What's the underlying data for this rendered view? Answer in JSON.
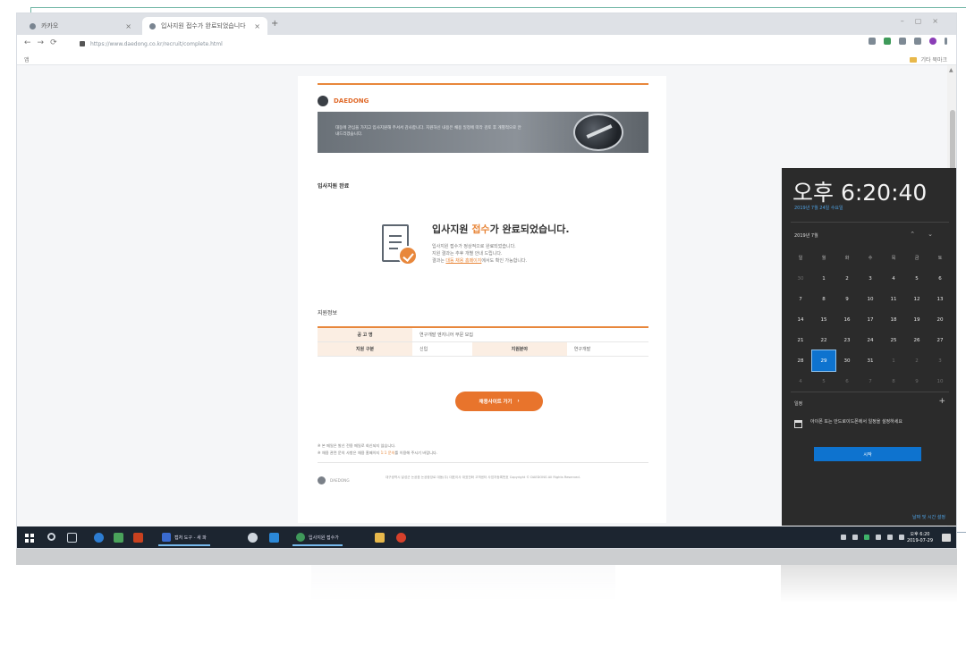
{
  "browser": {
    "tabs": [
      {
        "label": "카카오",
        "active": false
      },
      {
        "label": "입사지원 접수가 완료되었습니다",
        "active": true
      }
    ],
    "new_tab": "+",
    "url": "https://www.daedong.co.kr/recruit/complete.html",
    "bookmarks_left": "앱",
    "bookmarks_right": "기타 북마크"
  },
  "email": {
    "brand": "DAEDONG",
    "banner_text": "대동에 관심을 가지고 입사지원해 주셔서 감사합니다. 지원하신 내용은 채용 일정에 따라 검토 후 개별적으로 안내드리겠습니다.",
    "section_title": "입사지원 완료",
    "headline_prefix": "입사지원 ",
    "headline_emphasis": "접수",
    "headline_suffix": "가 완료되었습니다.",
    "notice_line1": "입사지원 접수가 정상적으로 완료되었습니다.",
    "notice_line2": "지원 결과는 추후 개별 안내 드립니다.",
    "notice_line3_prefix": "결과는 ",
    "notice_line3_link": "대동 채용 홈페이지",
    "notice_line3_suffix": "에서도 확인 가능합니다.",
    "info_title": "지원정보",
    "table": {
      "row1_header": "공 고 명",
      "row1_value": "연구개발 엔지니어 부문 모집",
      "row2_header1": "지원 구분",
      "row2_value1": "신입",
      "row2_header2": "지원분야",
      "row2_value2": "연구개발"
    },
    "cta_label": "채용사이트 가기",
    "cta_chevron": "›",
    "footnote1": "※ 본 메일은 발신 전용 메일로 회신되지 않습니다.",
    "footnote2_prefix": "※ 채용 관련 문의 사항은 채용 홈페이지 ",
    "footnote2_link": "1:1 문의",
    "footnote2_suffix": "를 이용해 주시기 바랍니다.",
    "footer_brand": "DAEDONG",
    "footer_legal": "대구광역시 달성군 논공읍 논공중앙로 대동(주) 대표이사 대표전화 고객센터 사업자등록번호 Copyright © DAEDONG All Rights Reserved."
  },
  "clock_flyout": {
    "time": "오후 6:20:40",
    "date": "2019년 7월 24일 수요일",
    "month_label": "2019년 7월",
    "weekdays": [
      "일",
      "월",
      "화",
      "수",
      "목",
      "금",
      "토"
    ],
    "weeks": [
      [
        {
          "d": "30",
          "dim": true
        },
        {
          "d": "1"
        },
        {
          "d": "2"
        },
        {
          "d": "3"
        },
        {
          "d": "4"
        },
        {
          "d": "5"
        },
        {
          "d": "6"
        }
      ],
      [
        {
          "d": "7"
        },
        {
          "d": "8"
        },
        {
          "d": "9"
        },
        {
          "d": "10"
        },
        {
          "d": "11"
        },
        {
          "d": "12"
        },
        {
          "d": "13"
        }
      ],
      [
        {
          "d": "14"
        },
        {
          "d": "15"
        },
        {
          "d": "16"
        },
        {
          "d": "17"
        },
        {
          "d": "18"
        },
        {
          "d": "19"
        },
        {
          "d": "20"
        }
      ],
      [
        {
          "d": "21"
        },
        {
          "d": "22"
        },
        {
          "d": "23"
        },
        {
          "d": "24"
        },
        {
          "d": "25"
        },
        {
          "d": "26"
        },
        {
          "d": "27"
        }
      ],
      [
        {
          "d": "28"
        },
        {
          "d": "29",
          "today": true
        },
        {
          "d": "30"
        },
        {
          "d": "31"
        },
        {
          "d": "1",
          "dim": true
        },
        {
          "d": "2",
          "dim": true
        },
        {
          "d": "3",
          "dim": true
        }
      ],
      [
        {
          "d": "4",
          "dim": true
        },
        {
          "d": "5",
          "dim": true
        },
        {
          "d": "6",
          "dim": true
        },
        {
          "d": "7",
          "dim": true
        },
        {
          "d": "8",
          "dim": true
        },
        {
          "d": "9",
          "dim": true
        },
        {
          "d": "10",
          "dim": true
        }
      ]
    ],
    "agenda_label": "일정",
    "agenda_add": "+",
    "agenda_text": "아이폰 또는 안드로이드폰에서 일정을 설정하세요",
    "agenda_button": "시작",
    "footer_link": "날짜 및 시간 설정"
  },
  "taskbar": {
    "apps": [
      {
        "label": "캡처 도구 - 새 파",
        "color": "#3a6bd0"
      },
      {
        "label": "입사지원 접수가",
        "color": "#3f9a5a"
      }
    ],
    "time": "오후 6:20",
    "date": "2019-07-29"
  },
  "colors": {
    "accent": "#e8873b",
    "cta": "#e8742c",
    "flyout_bg": "#2b2b2b",
    "today": "#0e73cf",
    "taskbar": "#1c2530"
  }
}
